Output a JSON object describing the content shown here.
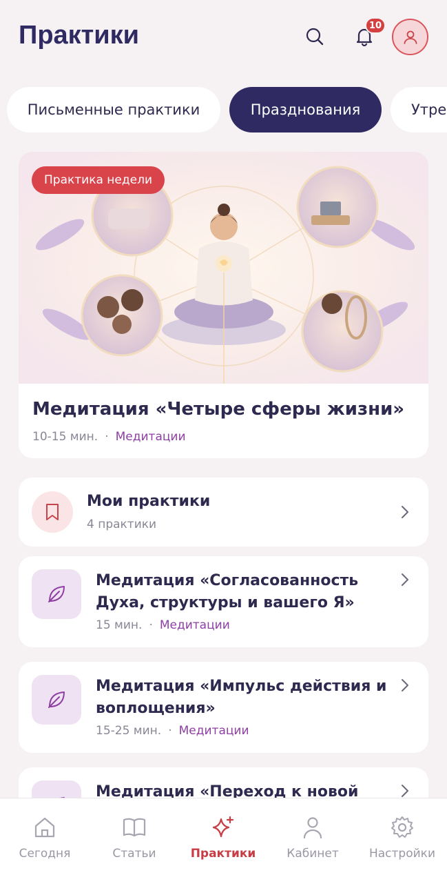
{
  "header": {
    "title": "Практики",
    "notification_count": "10"
  },
  "tabs": [
    {
      "label": "Письменные практики",
      "active": false
    },
    {
      "label": "Празднования",
      "active": true
    },
    {
      "label": "Утре",
      "active": false
    }
  ],
  "featured": {
    "badge": "Практика недели",
    "title": "Медитация «Четыре сферы жизни»",
    "duration": "10-15 мин.",
    "separator": "·",
    "category": "Медитации"
  },
  "my_practices": {
    "title": "Мои практики",
    "subtitle": "4 практики"
  },
  "practices": [
    {
      "title_line1": "Медитация «Согласованность",
      "title_line2": "Духа, структуры и вашего Я»",
      "duration": "15 мин.",
      "separator": "·",
      "category": "Медитации"
    },
    {
      "title_line1": "Медитация «Импульс действия и",
      "title_line2": "воплощения»",
      "duration": "15-25 мин.",
      "separator": "·",
      "category": "Медитации"
    },
    {
      "title_line1": "Медитация «Переход к новой"
    }
  ],
  "nav": [
    {
      "label": "Сегодня",
      "icon": "home-icon",
      "active": false
    },
    {
      "label": "Статьи",
      "icon": "book-icon",
      "active": false
    },
    {
      "label": "Практики",
      "icon": "sparkle-icon",
      "active": true
    },
    {
      "label": "Кабинет",
      "icon": "person-icon",
      "active": false
    },
    {
      "label": "Настройки",
      "icon": "gear-icon",
      "active": false
    }
  ],
  "colors": {
    "accent": "#2f2b62",
    "brand_red": "#d9434a",
    "category": "#8e3fa3",
    "background": "#f6f1f3"
  }
}
